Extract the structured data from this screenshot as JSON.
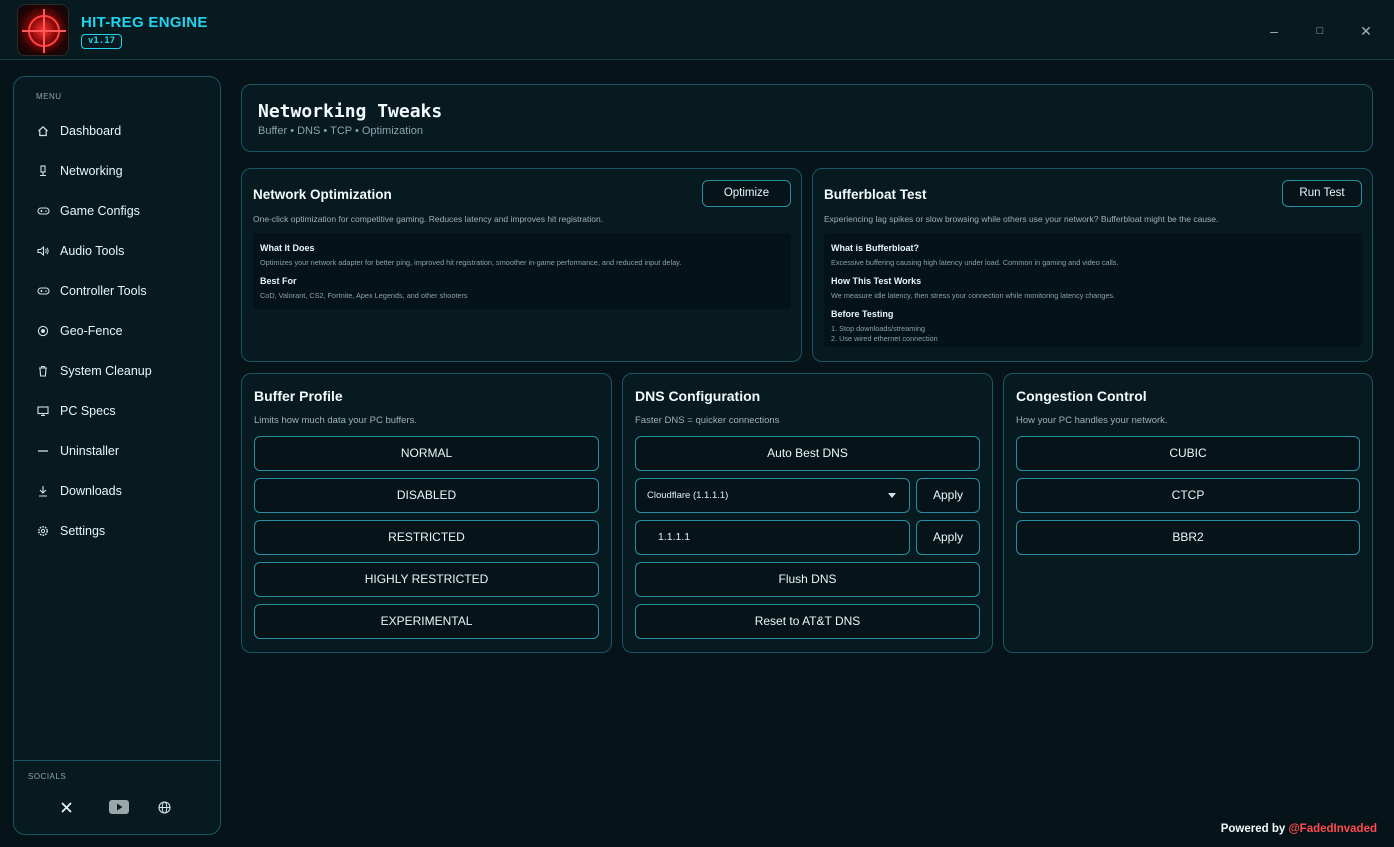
{
  "app": {
    "title": "HIT-REG ENGINE",
    "version": "v1.17"
  },
  "window_controls": {
    "minimize": "–",
    "maximize": "□",
    "close": "✕"
  },
  "sidebar": {
    "menu_label": "MENU",
    "items": [
      {
        "label": "Dashboard",
        "icon": "home-icon"
      },
      {
        "label": "Networking",
        "icon": "network-icon"
      },
      {
        "label": "Game Configs",
        "icon": "gamepad-icon"
      },
      {
        "label": "Audio Tools",
        "icon": "speaker-icon"
      },
      {
        "label": "Controller Tools",
        "icon": "controller-icon"
      },
      {
        "label": "Geo-Fence",
        "icon": "target-icon"
      },
      {
        "label": "System Cleanup",
        "icon": "trash-icon"
      },
      {
        "label": "PC Specs",
        "icon": "monitor-icon"
      },
      {
        "label": "Uninstaller",
        "icon": "minus-icon"
      },
      {
        "label": "Downloads",
        "icon": "download-icon"
      },
      {
        "label": "Settings",
        "icon": "gear-icon"
      }
    ],
    "socials_label": "SOCIALS",
    "socials": [
      "x-icon",
      "youtube-icon",
      "globe-icon"
    ]
  },
  "header": {
    "title": "Networking Tweaks",
    "subtitle": "Buffer • DNS • TCP • Optimization"
  },
  "network_optimization": {
    "title": "Network Optimization",
    "button": "Optimize",
    "description": "One-click optimization for competitive gaming. Reduces latency and improves hit registration.",
    "what_heading": "What It Does",
    "what_text": "Optimizes your network adapter for better ping, improved hit registration, smoother in-game performance, and reduced input delay.",
    "best_heading": "Best For",
    "best_text": "CoD, Valorant, CS2, Fortnite, Apex Legends, and other shooters"
  },
  "bufferbloat": {
    "title": "Bufferbloat Test",
    "button": "Run Test",
    "description": "Experiencing lag spikes or slow browsing while others use your network? Bufferbloat might be the cause.",
    "what_heading": "What is Bufferbloat?",
    "what_text": "Excessive buffering causing high latency under load. Common in gaming and video calls.",
    "how_heading": "How This Test Works",
    "how_text": "We measure idle latency, then stress your connection while monitoring latency changes.",
    "before_heading": "Before Testing",
    "before_1": "1. Stop downloads/streaming",
    "before_2": "2. Use wired ethernet connection"
  },
  "buffer_profile": {
    "title": "Buffer Profile",
    "description": "Limits how much data your PC buffers.",
    "options": [
      "NORMAL",
      "DISABLED",
      "RESTRICTED",
      "HIGHLY RESTRICTED",
      "EXPERIMENTAL"
    ]
  },
  "dns": {
    "title": "DNS Configuration",
    "description": "Faster DNS = quicker connections",
    "auto_button": "Auto Best DNS",
    "select_value": "Cloudflare (1.1.1.1)",
    "apply_label": "Apply",
    "input_value": "1.1.1.1",
    "flush_button": "Flush DNS",
    "reset_button": "Reset to AT&T DNS"
  },
  "congestion": {
    "title": "Congestion Control",
    "description": "How your PC handles your network.",
    "options": [
      "CUBIC",
      "CTCP",
      "BBR2"
    ]
  },
  "footer": {
    "prefix": "Powered by ",
    "handle": "@FadedInvaded"
  },
  "colors": {
    "accent": "#22d3ee",
    "border": "#1b5664",
    "brand_red": "#ff4b4b",
    "background": "#061419"
  }
}
